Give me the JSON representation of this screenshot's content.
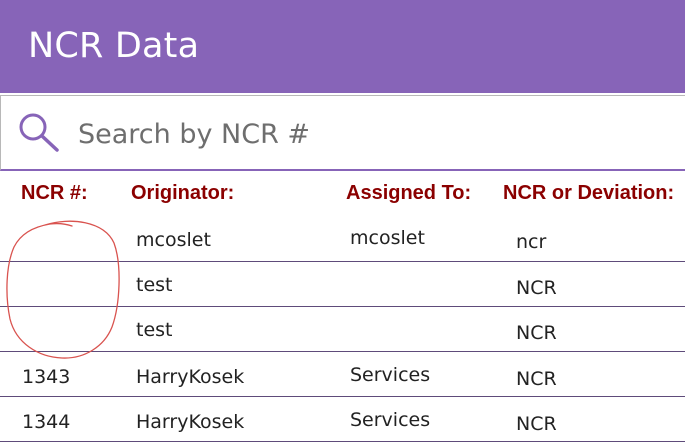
{
  "header": {
    "title": "NCR Data"
  },
  "search": {
    "placeholder": "Search by NCR #",
    "value": ""
  },
  "columns": [
    "NCR #:",
    "Originator:",
    "Assigned To:",
    "NCR or Deviation:"
  ],
  "rows": [
    {
      "ncr": "",
      "originator": "mcoslet",
      "assigned_to": "mcoslet",
      "type": "ncr"
    },
    {
      "ncr": "",
      "originator": "test",
      "assigned_to": "",
      "type": "NCR"
    },
    {
      "ncr": "",
      "originator": "test",
      "assigned_to": "",
      "type": "NCR"
    },
    {
      "ncr": "1343",
      "originator": "HarryKosek",
      "assigned_to": "Services",
      "type": "NCR"
    },
    {
      "ncr": "1344",
      "originator": "HarryKosek",
      "assigned_to": "Services",
      "type": "NCR"
    }
  ],
  "colors": {
    "header_bg": "#8764b8",
    "column_header": "#8b0000",
    "annotation": "#d9534f"
  }
}
